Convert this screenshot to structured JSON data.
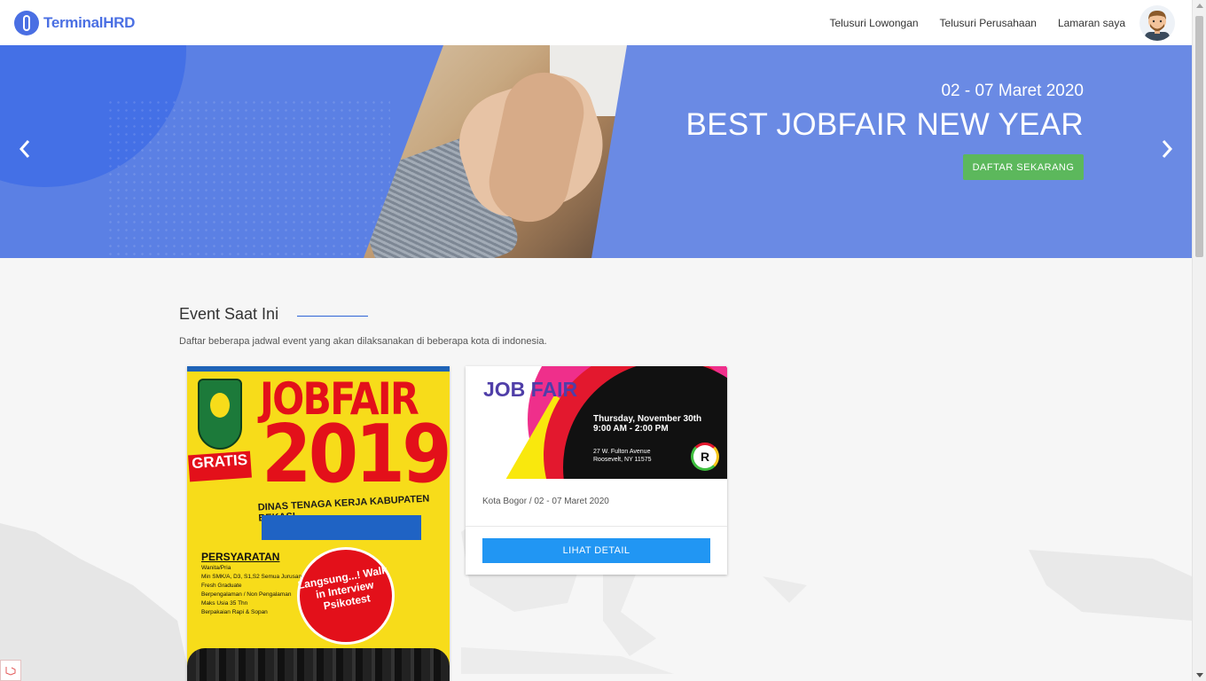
{
  "nav": {
    "brand": "TerminalHRD",
    "links": [
      "Telusuri Lowongan",
      "Telusuri Perusahaan",
      "Lamaran saya"
    ]
  },
  "hero": {
    "date": "02 - 07 Maret 2020",
    "title": "BEST JOBFAIR NEW YEAR",
    "cta": "DAFTAR SEKARANG"
  },
  "section": {
    "title": "Event Saat Ini",
    "description": "Daftar beberapa jadwal event yang akan dilaksanakan di beberapa kota di indonesia."
  },
  "poster": {
    "title_top": "JOBFAIR",
    "title_year": "2019",
    "gratis": "GRATIS",
    "subtitle": "DINAS TENAGA KERJA KABUPATEN BEKASI",
    "requirements_title": "PERSYARATAN",
    "requirements": [
      "Wanita/Pria",
      "Min SMK/A, D3, S1,S2 Semua Jurusan",
      "Fresh Graduate",
      "Berpengalaman / Non Pengalaman",
      "Maks Usia 35 Thn",
      "Berpakaian Rapi & Sopan"
    ],
    "circle_text": "Langsung...! Walk in Interview Psikotest"
  },
  "event_card": {
    "banner_title": "JOB FAIR",
    "banner_date": "Thursday, November 30th",
    "banner_time": "9:00 AM - 2:00 PM",
    "banner_address1": "27 W. Fulton Avenue",
    "banner_address2": "Roosevelt, NY 11575",
    "banner_logo": "R",
    "meta": "Kota Bogor / 02 - 07 Maret 2020",
    "button": "LIHAT DETAIL"
  },
  "colors": {
    "brand": "#4a6fe3",
    "hero": "#5b80e4",
    "cta_green": "#5cb85c",
    "detail_button": "#2196f3"
  }
}
